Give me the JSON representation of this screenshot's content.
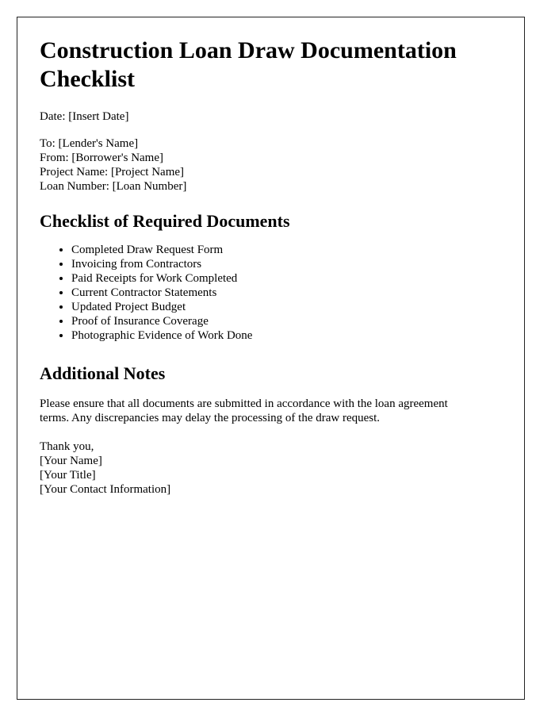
{
  "document": {
    "title": "Construction Loan Draw Documentation Checklist",
    "date_line": "Date: [Insert Date]",
    "meta": {
      "to": "To: [Lender's Name]",
      "from": "From: [Borrower's Name]",
      "project_name": "Project Name: [Project Name]",
      "loan_number": "Loan Number: [Loan Number]"
    },
    "checklist_section": {
      "heading": "Checklist of Required Documents",
      "items": [
        "Completed Draw Request Form",
        "Invoicing from Contractors",
        "Paid Receipts for Work Completed",
        "Current Contractor Statements",
        "Updated Project Budget",
        "Proof of Insurance Coverage",
        "Photographic Evidence of Work Done"
      ]
    },
    "notes_section": {
      "heading": "Additional Notes",
      "paragraph": "Please ensure that all documents are submitted in accordance with the loan agreement terms. Any discrepancies may delay the processing of the draw request."
    },
    "closing": {
      "thanks": "Thank you,",
      "name": "[Your Name]",
      "title": "[Your Title]",
      "contact": "[Your Contact Information]"
    },
    "colors": {
      "text": "#000000",
      "page_background": "#ffffff",
      "border": "#222222"
    }
  }
}
